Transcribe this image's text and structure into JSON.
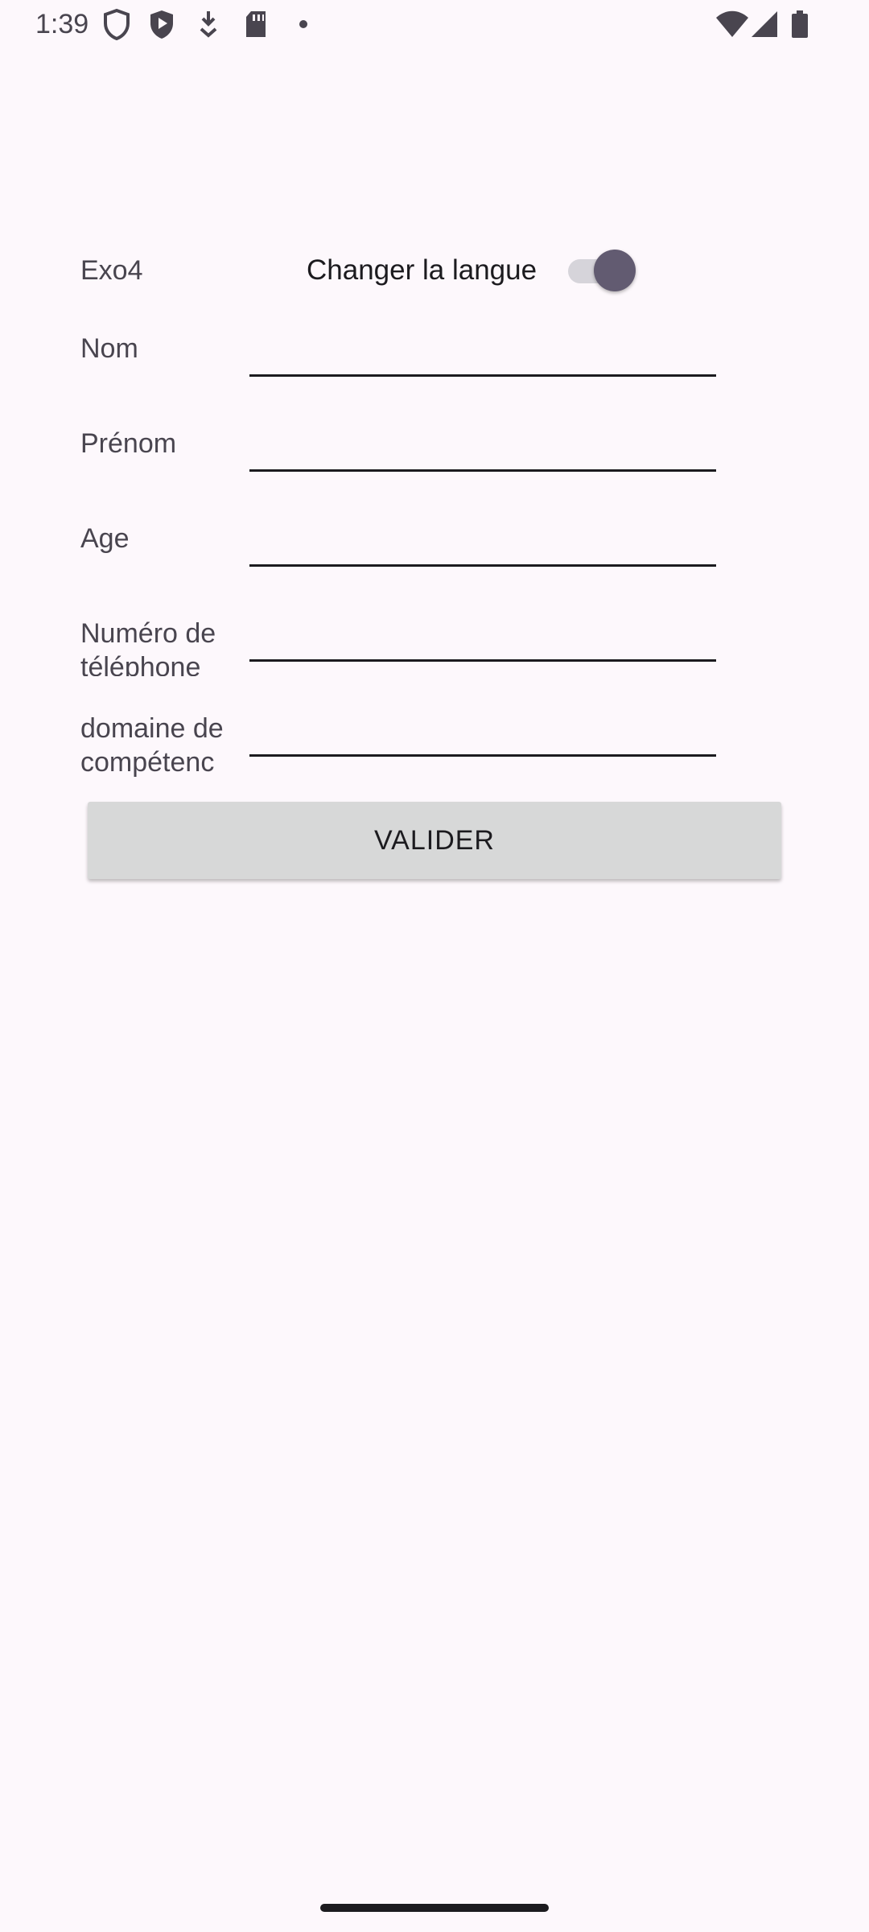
{
  "status_bar": {
    "time": "1:39",
    "left_icons": [
      "shield-outline-icon",
      "shield-play-icon",
      "download-icon",
      "sd-card-icon",
      "dot-icon"
    ],
    "right_icons": [
      "wifi-icon",
      "signal-icon",
      "battery-icon"
    ]
  },
  "app": {
    "title": "Exo4",
    "language_toggle": {
      "label": "Changer la langue",
      "checked": true,
      "accent_color": "#625b71"
    }
  },
  "form": {
    "fields": [
      {
        "label": "Nom",
        "value": ""
      },
      {
        "label": "Prénom",
        "value": ""
      },
      {
        "label": "Age",
        "value": ""
      },
      {
        "label": "Numéro de téléphone",
        "value": ""
      },
      {
        "label": "domaine de compétenc",
        "value": ""
      }
    ],
    "submit_label": "VALIDER"
  },
  "colors": {
    "background": "#fdf8fc",
    "button": "#d7d8d8",
    "label": "#49454f"
  }
}
